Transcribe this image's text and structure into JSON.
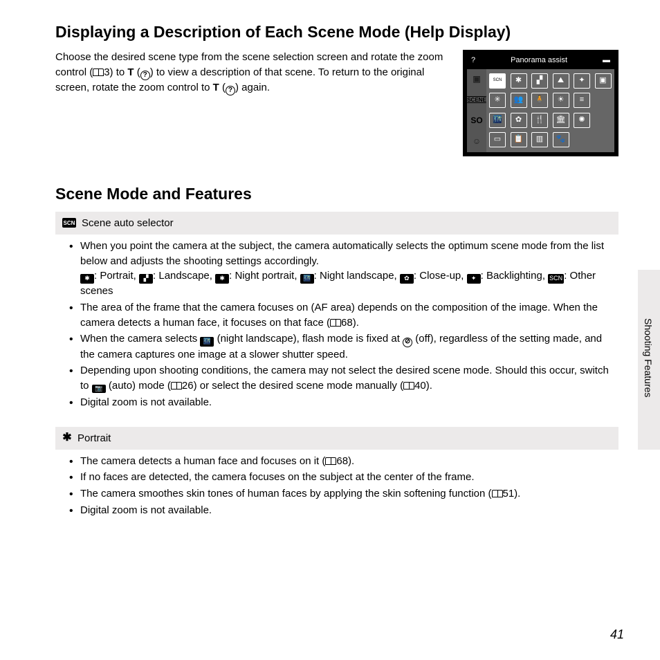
{
  "heading1": "Displaying a Description of Each Scene Mode (Help Display)",
  "intro": {
    "p1a": "Choose the desired scene type from the scene selection screen and rotate the zoom control (",
    "p1b": "3) to ",
    "boldT1": "T",
    "p1c": " (",
    "p1d": ") to view a description of that scene. To return to the original screen, rotate the zoom control to ",
    "boldT2": "T",
    "p1e": " (",
    "p1f": ") again."
  },
  "screen": {
    "title": "Panorama assist",
    "tabs": [
      "📷",
      "SCENE",
      "SO",
      "☺"
    ],
    "cells": [
      "SCENE",
      "✱",
      "▞",
      "🏔",
      "✦",
      "⬛",
      "✳",
      "👥",
      "🧍",
      "🌅",
      "🌅",
      "⬛",
      "🌃",
      "🌸",
      "🍴",
      "🏛",
      "✺",
      "▭",
      "📋",
      "▥",
      "🐾",
      "",
      ""
    ]
  },
  "heading2": "Scene Mode and Features",
  "mode1": {
    "title": "Scene auto selector",
    "b1a": "When you point the camera at the subject, the camera automatically selects the optimum scene mode from the list below and adjusts the shooting settings accordingly.",
    "b1b_portrait": ": Portrait, ",
    "b1b_landscape": ": Landscape, ",
    "b1b_nightport": ": Night portrait, ",
    "b1b_nightland": ": Night landscape, ",
    "b1b_closeup": ": Close-up, ",
    "b1b_backlight": ": Backlighting, ",
    "b1b_other": ": Other scenes",
    "b2a": "The area of the frame that the camera focuses on (AF area) depends on the composition of the image. When the camera detects a human face, it focuses on that face (",
    "b2b": "68).",
    "b3a": "When the camera selects ",
    "b3b": " (night landscape), flash mode is fixed at ",
    "b3c": " (off), regardless of the setting made, and the camera captures one image at a slower shutter speed.",
    "b4a": "Depending upon shooting conditions, the camera may not select the desired scene mode. Should this occur, switch to ",
    "b4b": " (auto) mode (",
    "b4c": "26) or select the desired scene mode manually (",
    "b4d": "40).",
    "b5": "Digital zoom is not available."
  },
  "mode2": {
    "title": "Portrait",
    "b1a": "The camera detects a human face and focuses on it (",
    "b1b": "68).",
    "b2": "If no faces are detected, the camera focuses on the subject at the center of the frame.",
    "b3a": "The camera smoothes skin tones of human faces by applying the skin softening function (",
    "b3b": "51).",
    "b4": "Digital zoom is not available."
  },
  "sideLabel": "Shooting Features",
  "pageNumber": "41"
}
